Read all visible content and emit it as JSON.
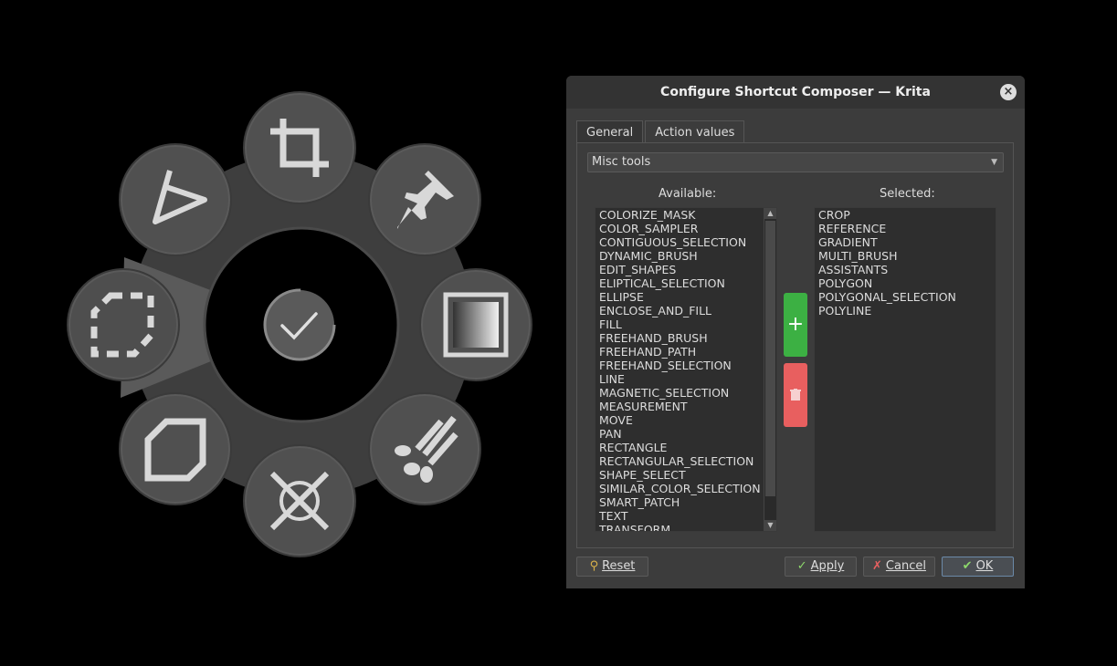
{
  "pie_menu": {
    "buttons": [
      {
        "name": "crop-tool-button",
        "icon": "crop-icon"
      },
      {
        "name": "reference-tool-button",
        "icon": "pin-icon"
      },
      {
        "name": "gradient-tool-button",
        "icon": "gradient-icon"
      },
      {
        "name": "multibrush-tool-button",
        "icon": "multibrush-icon"
      },
      {
        "name": "assistant-tool-button",
        "icon": "assistant-icon"
      },
      {
        "name": "polygon-tool-button",
        "icon": "polygon-icon"
      },
      {
        "name": "polygonal-selection-button",
        "icon": "polygonal-selection-icon"
      },
      {
        "name": "polyline-tool-button",
        "icon": "polyline-icon"
      }
    ],
    "center_icon": "accept-check-icon"
  },
  "dialog": {
    "title": "Configure Shortcut Composer — Krita",
    "close_icon": "close-icon",
    "tabs": [
      {
        "label": "General",
        "active": false
      },
      {
        "label": "Action values",
        "active": true
      }
    ],
    "group_select": {
      "value": "Misc tools"
    },
    "available_label": "Available:",
    "selected_label": "Selected:",
    "available": [
      "COLORIZE_MASK",
      "COLOR_SAMPLER",
      "CONTIGUOUS_SELECTION",
      "DYNAMIC_BRUSH",
      "EDIT_SHAPES",
      "ELIPTICAL_SELECTION",
      "ELLIPSE",
      "ENCLOSE_AND_FILL",
      "FILL",
      "FREEHAND_BRUSH",
      "FREEHAND_PATH",
      "FREEHAND_SELECTION",
      "LINE",
      "MAGNETIC_SELECTION",
      "MEASUREMENT",
      "MOVE",
      "PAN",
      "RECTANGLE",
      "RECTANGULAR_SELECTION",
      "SHAPE_SELECT",
      "SIMILAR_COLOR_SELECTION",
      "SMART_PATCH",
      "TEXT",
      "TRANSFORM"
    ],
    "selected": [
      "CROP",
      "REFERENCE",
      "GRADIENT",
      "MULTI_BRUSH",
      "ASSISTANTS",
      "POLYGON",
      "POLYGONAL_SELECTION",
      "POLYLINE"
    ],
    "add_label": "+",
    "buttons": {
      "reset": "Reset",
      "apply": "Apply",
      "cancel": "Cancel",
      "ok": "OK"
    },
    "colors": {
      "add": "#3cb043",
      "remove": "#e85f5f"
    }
  }
}
